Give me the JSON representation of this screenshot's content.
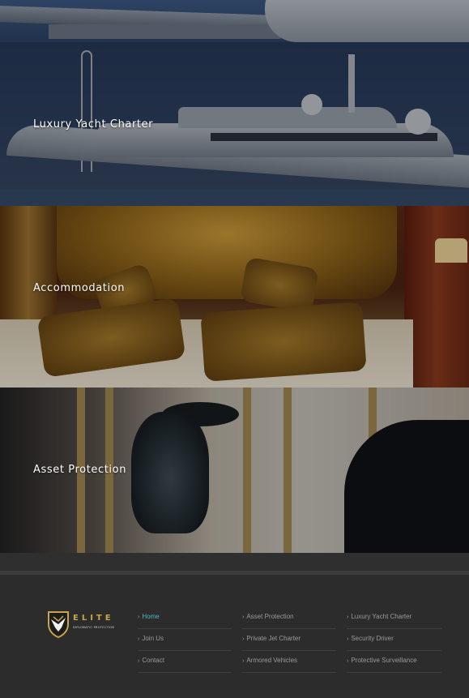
{
  "panels": [
    {
      "id": "jet",
      "label": ""
    },
    {
      "id": "yacht",
      "label": "Luxury Yacht Charter"
    },
    {
      "id": "accommodation",
      "label": "Accommodation"
    },
    {
      "id": "asset",
      "label": "Asset Protection"
    }
  ],
  "footer": {
    "logo": {
      "name": "ELITE",
      "tagline": "DIPLOMATIC PROTECTION",
      "icon": "shield-eagle-icon",
      "accent": "#c9a44b"
    },
    "chevron": "›",
    "columns": [
      [
        {
          "label": "Home",
          "active": true
        },
        {
          "label": "Join Us"
        },
        {
          "label": "Contact"
        }
      ],
      [
        {
          "label": "Asset Protection"
        },
        {
          "label": "Private Jet Charter"
        },
        {
          "label": "Armored Vehicles"
        }
      ],
      [
        {
          "label": "Luxury Yacht Charter"
        },
        {
          "label": "Security Driver"
        },
        {
          "label": "Protective Surveillance"
        }
      ]
    ],
    "active_color": "#4fb7c0"
  }
}
